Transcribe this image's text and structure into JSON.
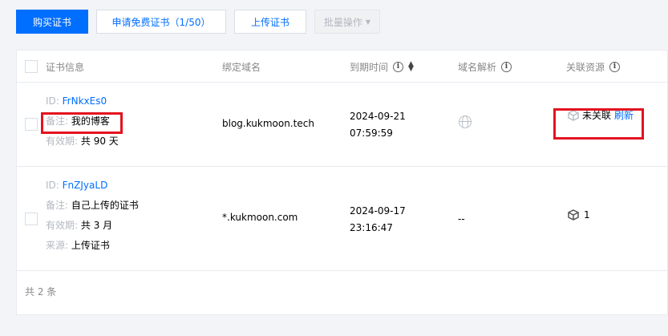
{
  "toolbar": {
    "buy_label": "购买证书",
    "apply_label": "申请免费证书（1/50）",
    "upload_label": "上传证书",
    "batch_label": "批量操作"
  },
  "table": {
    "headers": {
      "cert_info": "证书信息",
      "domain": "绑定域名",
      "expiry": "到期时间",
      "dns": "域名解析",
      "resources": "关联资源"
    },
    "rows": [
      {
        "id_key": "ID:",
        "id": "FrNkxEs0",
        "remark_key": "备注:",
        "remark": "我的博客",
        "validity_key": "有效期:",
        "validity": "共 90 天",
        "domain": "blog.kukmoon.tech",
        "expiry_date": "2024-09-21",
        "expiry_time": "07:59:59",
        "dns": "globe",
        "resource_status": "未关联",
        "refresh_label": "刷新"
      },
      {
        "id_key": "ID:",
        "id": "FnZJyaLD",
        "remark_key": "备注:",
        "remark": "自己上传的证书",
        "validity_key": "有效期:",
        "validity": "共 3 月",
        "source_key": "来源:",
        "source": "上传证书",
        "domain": "*.kukmoon.com",
        "expiry_date": "2024-09-17",
        "expiry_time": "23:16:47",
        "dns": "--",
        "resource_count": "1"
      }
    ],
    "footer": "共 2 条"
  },
  "colors": {
    "accent": "#006eff",
    "highlight": "#e3131f"
  },
  "icons": [
    "info-icon",
    "sort-icon",
    "globe-icon",
    "cube-icon",
    "caret-down-icon"
  ]
}
